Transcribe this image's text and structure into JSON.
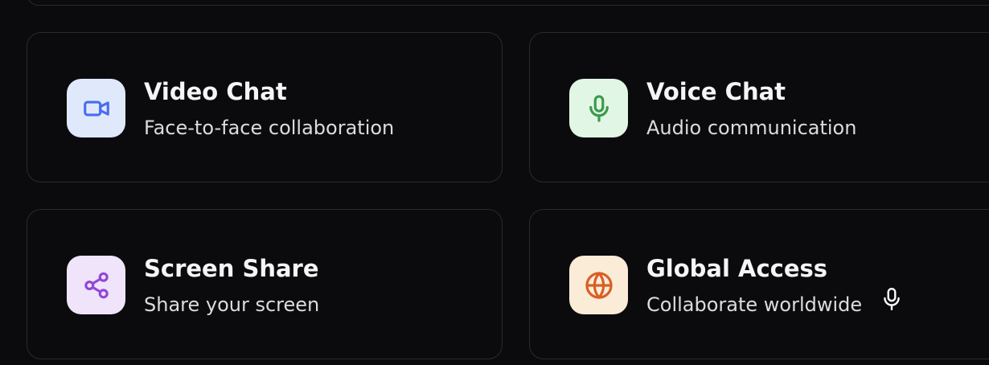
{
  "features": [
    {
      "title": "Video Chat",
      "subtitle": "Face-to-face collaboration",
      "icon": "video-camera-icon",
      "icon_bg": "#e0e9fb",
      "icon_color": "#4a6cf0"
    },
    {
      "title": "Voice Chat",
      "subtitle": "Audio communication",
      "icon": "microphone-icon",
      "icon_bg": "#e1f6e4",
      "icon_color": "#3a9a4c"
    },
    {
      "title": "Screen Share",
      "subtitle": "Share your screen",
      "icon": "share-icon",
      "icon_bg": "#f0e4fb",
      "icon_color": "#9247d8"
    },
    {
      "title": "Global Access",
      "subtitle": "Collaborate worldwide",
      "icon": "globe-icon",
      "icon_bg": "#fbecd8",
      "icon_color": "#d85f24"
    }
  ],
  "floating_icon": "microphone-icon",
  "colors": {
    "background": "#0b0b0d",
    "card_border": "#2a2a2e",
    "title_text": "#f5f5f5",
    "subtitle_text": "#dcdcdc"
  }
}
